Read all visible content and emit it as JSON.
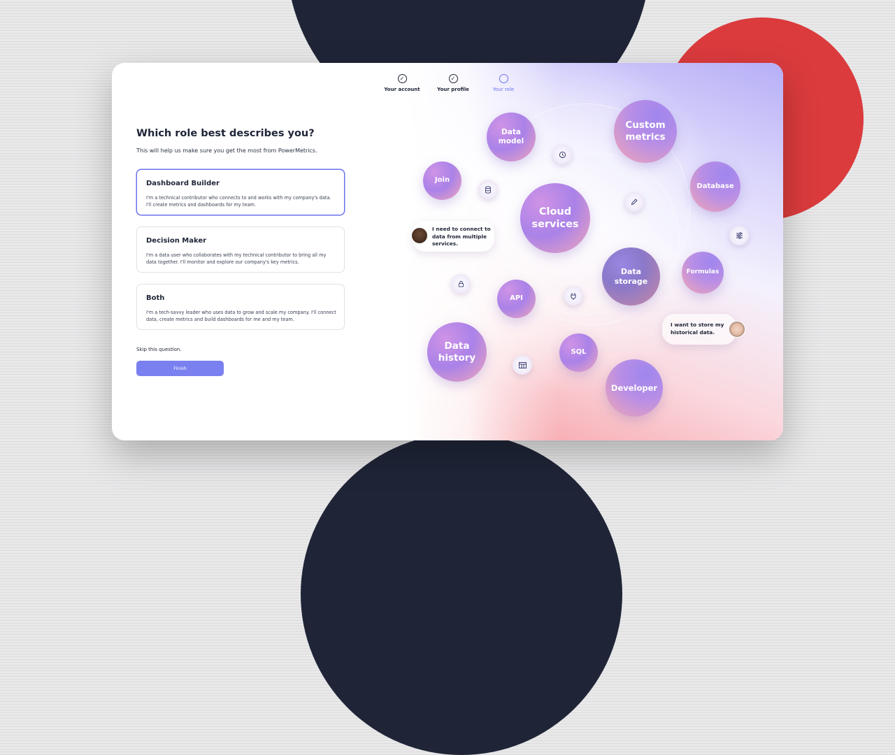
{
  "stepper": [
    {
      "label": "Your account",
      "state": "done",
      "icon": "check-icon"
    },
    {
      "label": "Your profile",
      "state": "done",
      "icon": "check-icon"
    },
    {
      "label": "Your role",
      "state": "current",
      "icon": "circle-icon"
    }
  ],
  "form": {
    "title": "Which role best describes you?",
    "subtitle": "This will help us make sure you get the most from PowerMetrics.",
    "options": [
      {
        "title": "Dashboard Builder",
        "description": "I'm a technical contributor who connects to and works with my company's data. I'll create metrics and dashboards for my team.",
        "selected": true
      },
      {
        "title": "Decision Maker",
        "description": "I'm a data user who collaborates with my technical contributor to bring all my data together. I'll monitor and explore our company's key metrics.",
        "selected": false
      },
      {
        "title": "Both",
        "description": "I'm a tech-savvy leader who uses data to grow and scale my company. I'll connect data, create metrics and build dashboards for me and my team.",
        "selected": false
      }
    ],
    "skip_label": "Skip this question.",
    "finish_label": "Finish"
  },
  "illustration": {
    "bubbles": {
      "data_model": [
        "Data",
        "model"
      ],
      "custom_metrics": [
        "Custom",
        "metrics"
      ],
      "join": [
        "Join"
      ],
      "database": [
        "Database"
      ],
      "cloud_services": [
        "Cloud",
        "services"
      ],
      "data_storage": [
        "Data",
        "storage"
      ],
      "formulas": [
        "Formulas"
      ],
      "api": [
        "API"
      ],
      "data_history": [
        "Data",
        "history"
      ],
      "sql": [
        "SQL"
      ],
      "developer": [
        "Developer"
      ]
    },
    "icons": [
      "history-icon",
      "database-icon",
      "pencil-icon",
      "sliders-icon",
      "lock-icon",
      "plug-icon",
      "table-icon"
    ],
    "chats": {
      "left": "I need to connect to data from multiple services.",
      "right": "I want to store my historical data."
    }
  },
  "colors": {
    "accent": "#6b72ee",
    "button": "#7a80ef",
    "navy": "#1f2537",
    "red": "#db3b3d"
  }
}
